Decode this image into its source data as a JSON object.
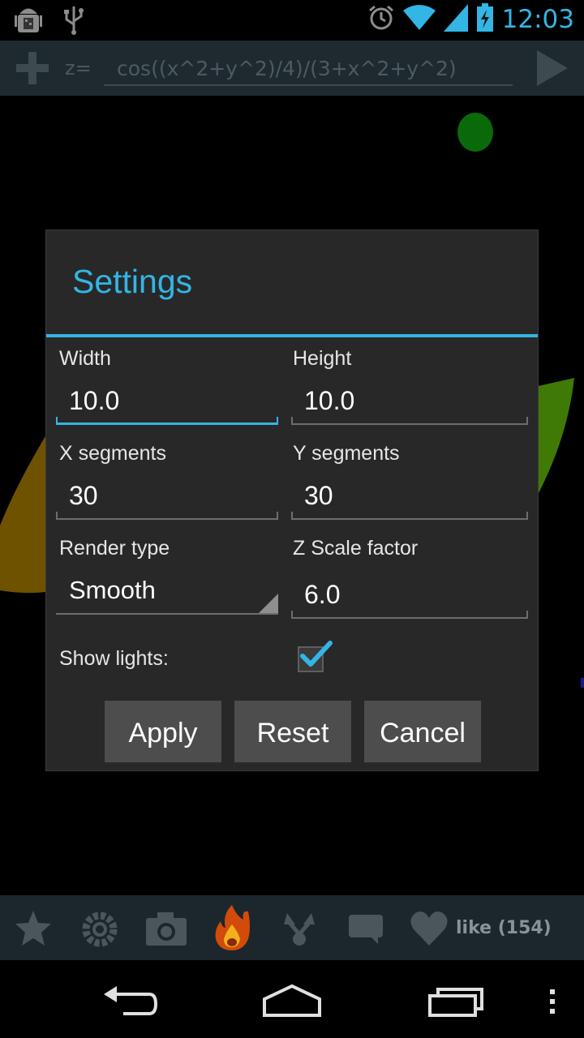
{
  "status_bar": {
    "time": "12:03",
    "icons": [
      "android-debug-icon",
      "usb-icon",
      "alarm-icon",
      "wifi-icon",
      "signal-icon",
      "battery-charging-icon"
    ]
  },
  "toolbar": {
    "z_label": "z=",
    "formula": "cos((x^2+y^2)/4)/(3+x^2+y^2)"
  },
  "dialog": {
    "title": "Settings",
    "width_label": "Width",
    "width_value": "10.0",
    "height_label": "Height",
    "height_value": "10.0",
    "x_segments_label": "X segments",
    "x_segments_value": "30",
    "y_segments_label": "Y segments",
    "y_segments_value": "30",
    "render_type_label": "Render type",
    "render_type_value": "Smooth",
    "z_scale_label": "Z Scale factor",
    "z_scale_value": "6.0",
    "show_lights_label": "Show lights:",
    "show_lights_checked": true,
    "apply_label": "Apply",
    "reset_label": "Reset",
    "cancel_label": "Cancel"
  },
  "bottom_bar": {
    "like_text": "like (154)"
  },
  "colors": {
    "accent": "#33b5e5",
    "dialog_bg": "#282828",
    "button_bg": "#4d4d4d"
  }
}
